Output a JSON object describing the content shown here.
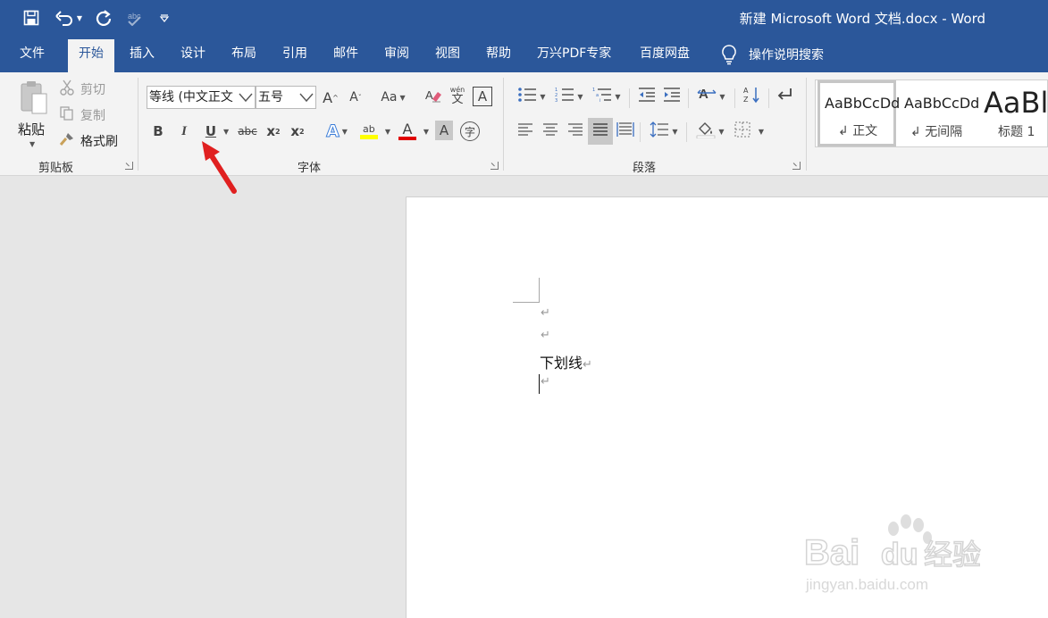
{
  "window": {
    "title": "新建 Microsoft Word 文档.docx  -  Word",
    "qat": [
      "save-icon",
      "undo-icon",
      "redo-icon",
      "spelling-icon",
      "customize-icon"
    ]
  },
  "tabs": [
    {
      "label": "文件",
      "active": false
    },
    {
      "label": "开始",
      "active": true
    },
    {
      "label": "插入",
      "active": false
    },
    {
      "label": "设计",
      "active": false
    },
    {
      "label": "布局",
      "active": false
    },
    {
      "label": "引用",
      "active": false
    },
    {
      "label": "邮件",
      "active": false
    },
    {
      "label": "审阅",
      "active": false
    },
    {
      "label": "视图",
      "active": false
    },
    {
      "label": "帮助",
      "active": false
    },
    {
      "label": "万兴PDF专家",
      "active": false
    },
    {
      "label": "百度网盘",
      "active": false
    }
  ],
  "tell_me": {
    "label": "操作说明搜索"
  },
  "clipboard": {
    "paste": "粘贴",
    "cut": "剪切",
    "copy": "复制",
    "format_painter": "格式刷",
    "group_label": "剪贴板"
  },
  "font": {
    "font_name": "等线 (中文正文",
    "font_size": "五号",
    "grow": "A",
    "shrink": "A",
    "change_case": "Aa",
    "pinyin_top": "wén",
    "pinyin_bottom": "文",
    "char_border": "A",
    "bold": "B",
    "italic": "I",
    "underline": "U",
    "strikethrough": "abc",
    "subscript": "x",
    "superscript": "x",
    "text_effects": "A",
    "highlight": "ab",
    "font_color": "A",
    "char_shading": "A",
    "enclose": "字",
    "group_label": "字体"
  },
  "paragraph": {
    "group_label": "段落"
  },
  "styles": {
    "items": [
      {
        "sample": "AaBbCcDd",
        "name": "正文"
      },
      {
        "sample": "AaBbCcDd",
        "name": "无间隔"
      },
      {
        "sample": "AaBl",
        "name": "标题 1"
      }
    ]
  },
  "document": {
    "text": "下划线"
  },
  "colors": {
    "title_bar": "#2b579a",
    "ribbon": "#f3f3f3",
    "highlight_yellow": "#ffff00",
    "font_color_red": "#e00000",
    "annotation_arrow": "#e02020"
  }
}
